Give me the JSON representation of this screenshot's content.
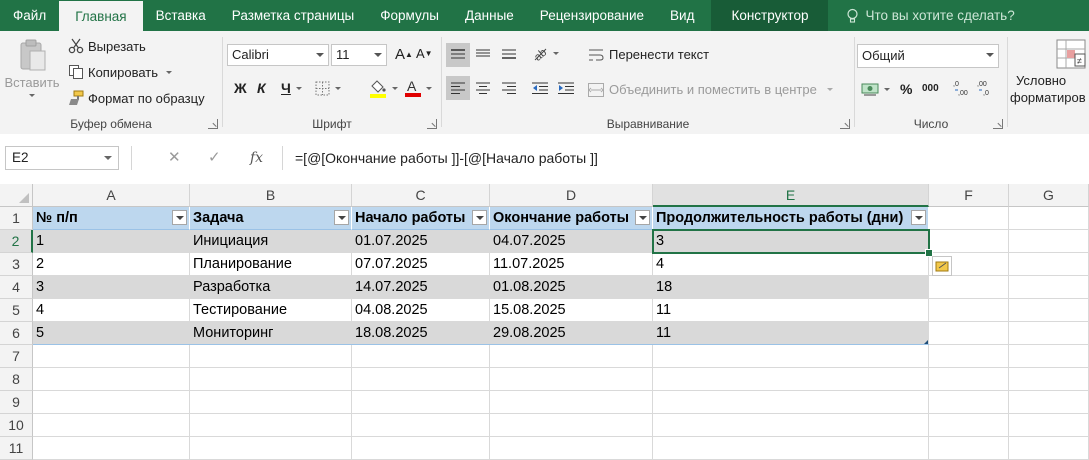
{
  "tabs": [
    "Файл",
    "Главная",
    "Вставка",
    "Разметка страницы",
    "Формулы",
    "Данные",
    "Рецензирование",
    "Вид"
  ],
  "active_tab": "Главная",
  "context_tab": "Конструктор",
  "tell_me": "Что вы хотите сделать?",
  "clipboard": {
    "paste": "Вставить",
    "cut": "Вырезать",
    "copy": "Копировать",
    "format_painter": "Формат по образцу",
    "label": "Буфер обмена"
  },
  "font": {
    "name": "Calibri",
    "size": "11",
    "bold": "Ж",
    "italic": "К",
    "underline": "Ч",
    "label": "Шрифт"
  },
  "alignment": {
    "wrap_text": "Перенести текст",
    "merge_center": "Объединить и поместить в центре",
    "label": "Выравнивание"
  },
  "number": {
    "format": "Общий",
    "percent": "%",
    "thousands": "000",
    "label": "Число"
  },
  "styles": {
    "conditional": "Условно",
    "formatting": "форматиров"
  },
  "formula_bar": {
    "name_box": "E2",
    "cancel": "✕",
    "enter": "✓",
    "fx": "fx",
    "formula": "=[@[Окончание работы ]]-[@[Начало работы ]]"
  },
  "columns": [
    "A",
    "B",
    "C",
    "D",
    "E",
    "F",
    "G"
  ],
  "rows": [
    "1",
    "2",
    "3",
    "4",
    "5",
    "6",
    "7",
    "8",
    "9",
    "10",
    "11"
  ],
  "table": {
    "headers": [
      "№ п/п",
      "Задача",
      "Начало работы",
      "Окончание работы",
      "Продолжительность работы (дни)"
    ],
    "rows": [
      [
        "1",
        "Инициация",
        "01.07.2025",
        "04.07.2025",
        "3"
      ],
      [
        "2",
        "Планирование",
        "07.07.2025",
        "11.07.2025",
        "4"
      ],
      [
        "3",
        "Разработка",
        "14.07.2025",
        "01.08.2025",
        "18"
      ],
      [
        "4",
        "Тестирование",
        "04.08.2025",
        "15.08.2025",
        "11"
      ],
      [
        "5",
        "Мониторинг",
        "18.08.2025",
        "29.08.2025",
        "11"
      ]
    ]
  },
  "colors": {
    "accent": "#217346",
    "header_fill": "#bdd7ee",
    "band_fill": "#d9d9d9"
  }
}
